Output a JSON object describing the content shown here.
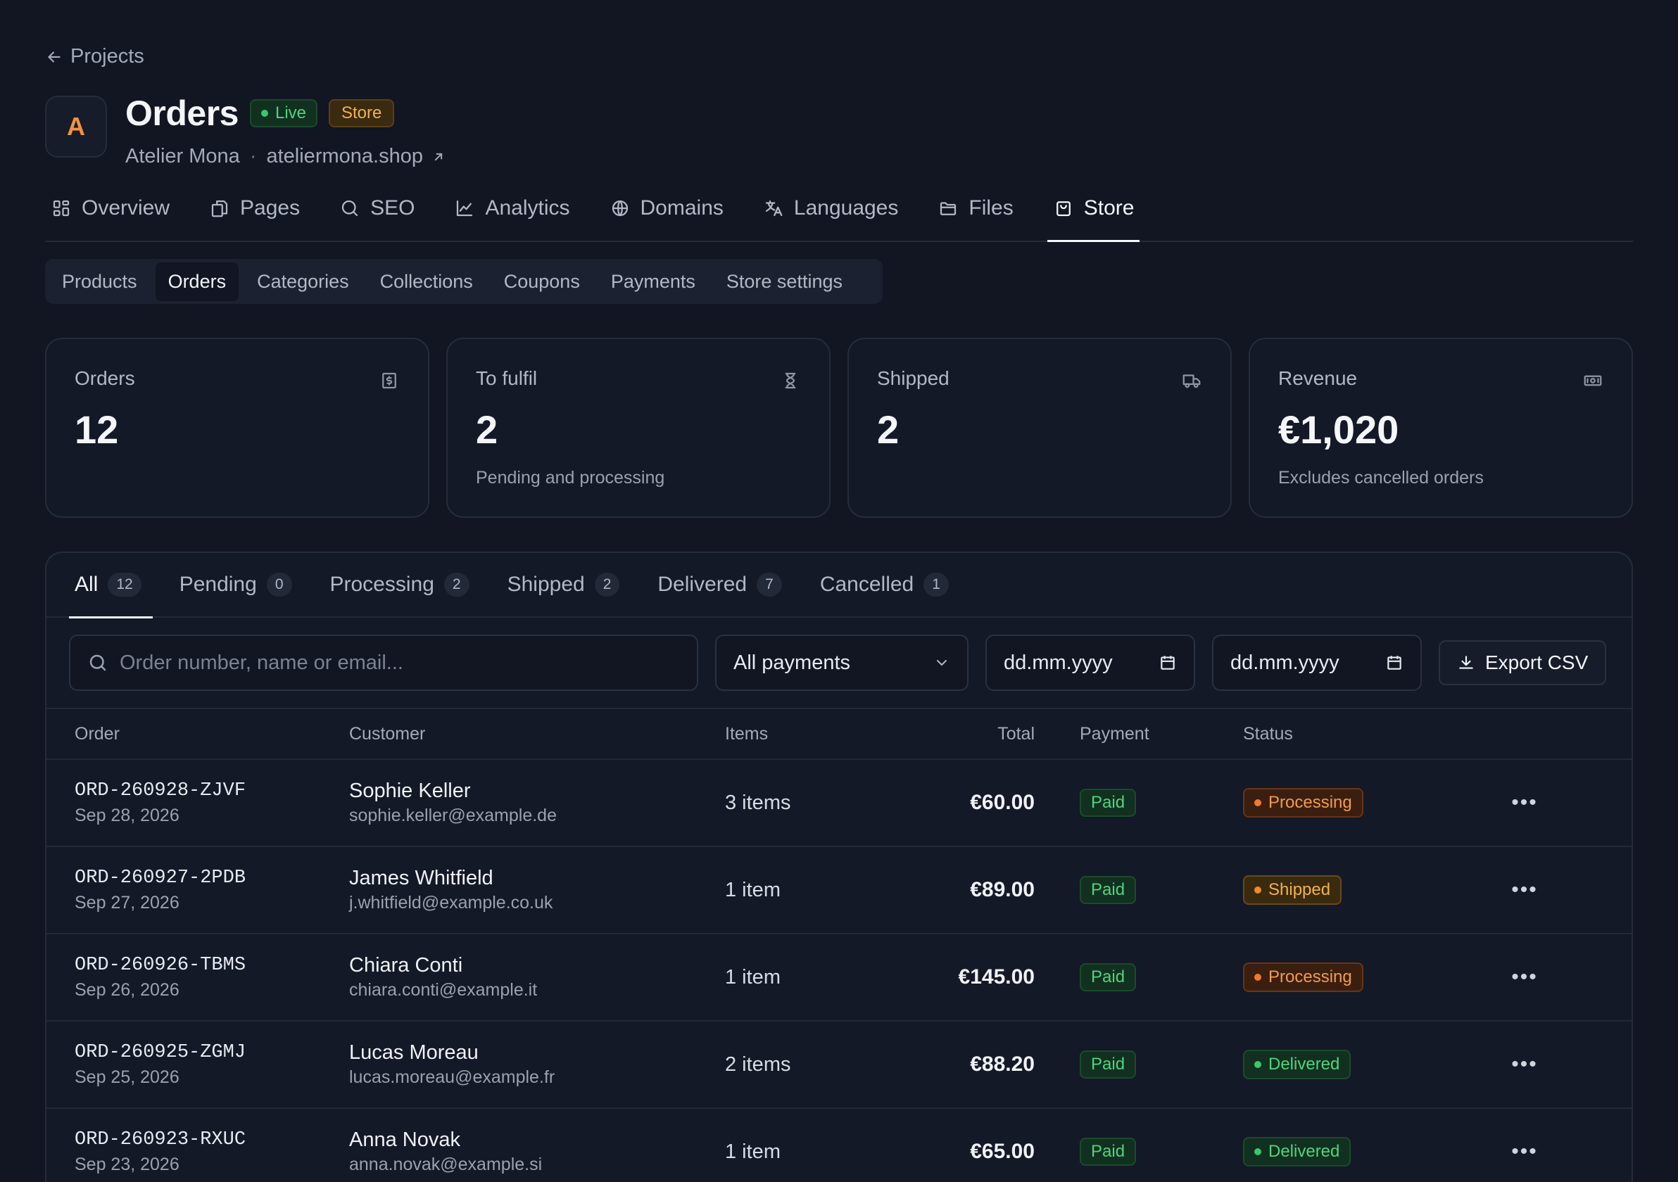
{
  "back_link": "Projects",
  "header": {
    "avatar_letter": "A",
    "title": "Orders",
    "live_badge": "Live",
    "store_badge": "Store",
    "site_name": "Atelier Mona",
    "site_sep": "·",
    "site_domain": "ateliermona.shop"
  },
  "main_nav": [
    {
      "label": "Overview",
      "icon": "grid-icon"
    },
    {
      "label": "Pages",
      "icon": "pages-icon"
    },
    {
      "label": "SEO",
      "icon": "search-icon"
    },
    {
      "label": "Analytics",
      "icon": "chart-icon"
    },
    {
      "label": "Domains",
      "icon": "globe-icon"
    },
    {
      "label": "Languages",
      "icon": "translate-icon"
    },
    {
      "label": "Files",
      "icon": "folder-icon"
    },
    {
      "label": "Store",
      "icon": "bag-icon",
      "active": true
    }
  ],
  "sub_nav": [
    {
      "label": "Products"
    },
    {
      "label": "Orders",
      "active": true
    },
    {
      "label": "Categories"
    },
    {
      "label": "Collections"
    },
    {
      "label": "Coupons"
    },
    {
      "label": "Payments"
    },
    {
      "label": "Store settings"
    }
  ],
  "stats": [
    {
      "label": "Orders",
      "value": "12",
      "sub": "",
      "icon": "invoice-icon"
    },
    {
      "label": "To fulfil",
      "value": "2",
      "sub": "Pending and processing",
      "icon": "hourglass-icon"
    },
    {
      "label": "Shipped",
      "value": "2",
      "sub": "",
      "icon": "truck-icon"
    },
    {
      "label": "Revenue",
      "value": "€1,020",
      "sub": "Excludes cancelled orders",
      "icon": "banknote-icon"
    }
  ],
  "tabs": [
    {
      "label": "All",
      "count": "12",
      "active": true
    },
    {
      "label": "Pending",
      "count": "0"
    },
    {
      "label": "Processing",
      "count": "2"
    },
    {
      "label": "Shipped",
      "count": "2"
    },
    {
      "label": "Delivered",
      "count": "7"
    },
    {
      "label": "Cancelled",
      "count": "1"
    }
  ],
  "filters": {
    "search_placeholder": "Order number, name or email...",
    "payment_select": "All payments",
    "date_from": "dd.mm.yyyy",
    "date_to": "dd.mm.yyyy",
    "export_label": "Export CSV"
  },
  "table": {
    "columns": {
      "order": "Order",
      "customer": "Customer",
      "items": "Items",
      "total": "Total",
      "payment": "Payment",
      "status": "Status"
    },
    "rows": [
      {
        "id": "ORD-260928-ZJVF",
        "date": "Sep 28, 2026",
        "name": "Sophie Keller",
        "email": "sophie.keller@example.de",
        "items": "3 items",
        "total": "€60.00",
        "payment": "Paid",
        "status": "Processing",
        "status_key": "processing"
      },
      {
        "id": "ORD-260927-2PDB",
        "date": "Sep 27, 2026",
        "name": "James Whitfield",
        "email": "j.whitfield@example.co.uk",
        "items": "1 item",
        "total": "€89.00",
        "payment": "Paid",
        "status": "Shipped",
        "status_key": "shipped"
      },
      {
        "id": "ORD-260926-TBMS",
        "date": "Sep 26, 2026",
        "name": "Chiara Conti",
        "email": "chiara.conti@example.it",
        "items": "1 item",
        "total": "€145.00",
        "payment": "Paid",
        "status": "Processing",
        "status_key": "processing"
      },
      {
        "id": "ORD-260925-ZGMJ",
        "date": "Sep 25, 2026",
        "name": "Lucas Moreau",
        "email": "lucas.moreau@example.fr",
        "items": "2 items",
        "total": "€88.20",
        "payment": "Paid",
        "status": "Delivered",
        "status_key": "delivered"
      },
      {
        "id": "ORD-260923-RXUC",
        "date": "Sep 23, 2026",
        "name": "Anna Novak",
        "email": "anna.novak@example.si",
        "items": "1 item",
        "total": "€65.00",
        "payment": "Paid",
        "status": "Delivered",
        "status_key": "delivered"
      }
    ]
  },
  "colors": {
    "background": "#111622",
    "accent_orange": "#f3923f",
    "success_green": "#4fd47f",
    "warning_amber": "#f2b24a"
  }
}
